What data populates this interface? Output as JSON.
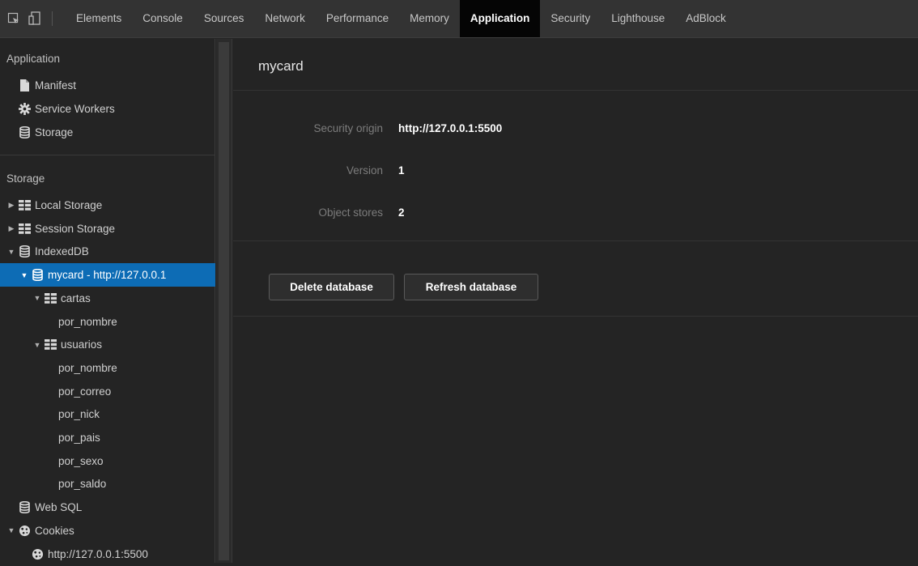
{
  "toolbar": {
    "tool_icons": [
      "inspect-element-icon",
      "device-toolbar-icon"
    ],
    "tabs": [
      {
        "label": "Elements",
        "active": false
      },
      {
        "label": "Console",
        "active": false
      },
      {
        "label": "Sources",
        "active": false
      },
      {
        "label": "Network",
        "active": false
      },
      {
        "label": "Performance",
        "active": false
      },
      {
        "label": "Memory",
        "active": false
      },
      {
        "label": "Application",
        "active": true
      },
      {
        "label": "Security",
        "active": false
      },
      {
        "label": "Lighthouse",
        "active": false
      },
      {
        "label": "AdBlock",
        "active": false
      }
    ]
  },
  "sidebar": {
    "application_title": "Application",
    "application_items": [
      {
        "label": "Manifest",
        "icon": "document-icon"
      },
      {
        "label": "Service Workers",
        "icon": "gear-icon"
      },
      {
        "label": "Storage",
        "icon": "database-icon"
      }
    ],
    "storage_title": "Storage",
    "tree": [
      {
        "label": "Local Storage",
        "icon": "grid-icon",
        "arrow": "▶",
        "level": 0
      },
      {
        "label": "Session Storage",
        "icon": "grid-icon",
        "arrow": "▶",
        "level": 0
      },
      {
        "label": "IndexedDB",
        "icon": "database-icon",
        "arrow": "▼",
        "level": 0
      },
      {
        "label": "mycard - http://127.0.0.1",
        "icon": "database-icon",
        "arrow": "▼",
        "level": 1,
        "selected": true
      },
      {
        "label": "cartas",
        "icon": "grid-icon",
        "arrow": "▼",
        "level": 2
      },
      {
        "label": "por_nombre",
        "icon": "",
        "arrow": "",
        "level": 3
      },
      {
        "label": "usuarios",
        "icon": "grid-icon",
        "arrow": "▼",
        "level": 2
      },
      {
        "label": "por_nombre",
        "icon": "",
        "arrow": "",
        "level": 3
      },
      {
        "label": "por_correo",
        "icon": "",
        "arrow": "",
        "level": 3
      },
      {
        "label": "por_nick",
        "icon": "",
        "arrow": "",
        "level": 3
      },
      {
        "label": "por_pais",
        "icon": "",
        "arrow": "",
        "level": 3
      },
      {
        "label": "por_sexo",
        "icon": "",
        "arrow": "",
        "level": 3
      },
      {
        "label": "por_saldo",
        "icon": "",
        "arrow": "",
        "level": 3
      },
      {
        "label": "Web SQL",
        "icon": "database-icon",
        "arrow": "",
        "level": 0
      },
      {
        "label": "Cookies",
        "icon": "cookie-icon",
        "arrow": "▼",
        "level": 0
      },
      {
        "label": "http://127.0.0.1:5500",
        "icon": "cookie-icon",
        "arrow": "",
        "level": 1
      }
    ]
  },
  "main": {
    "title": "mycard",
    "properties": [
      {
        "label": "Security origin",
        "value": "http://127.0.0.1:5500"
      },
      {
        "label": "Version",
        "value": "1"
      },
      {
        "label": "Object stores",
        "value": "2"
      }
    ],
    "delete_label": "Delete database",
    "refresh_label": "Refresh database"
  },
  "colors": {
    "selected_row": "#0d6cb5",
    "active_tab": "#050505",
    "background": "#242424",
    "toolbar": "#333333"
  }
}
